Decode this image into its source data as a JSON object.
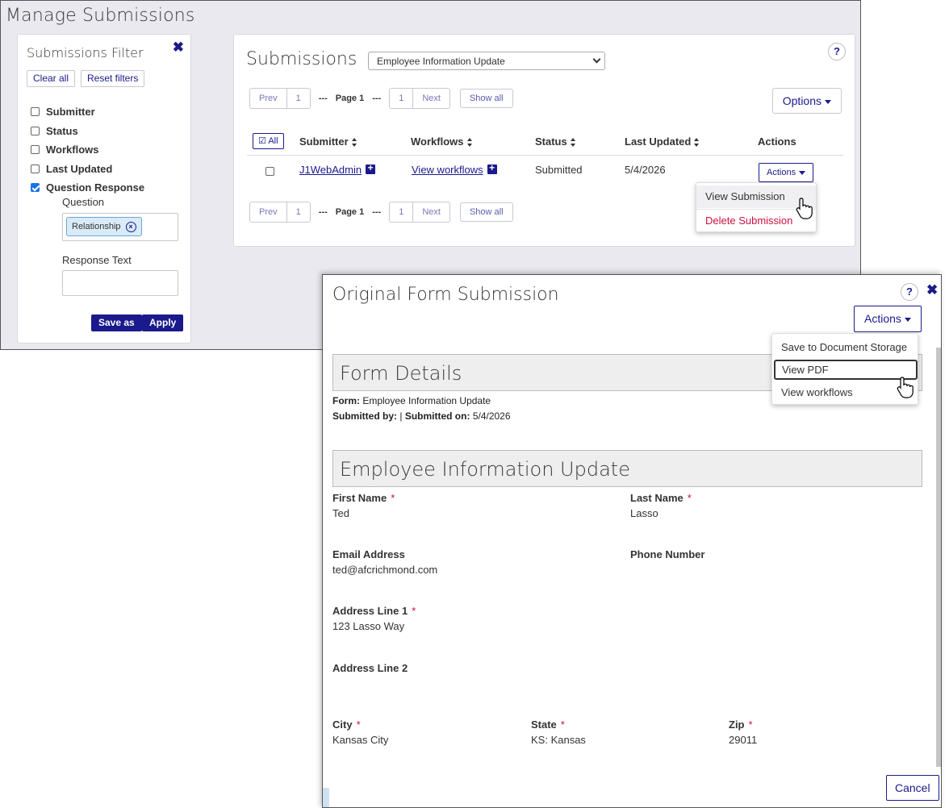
{
  "manage": {
    "title": "Manage Submissions"
  },
  "filter": {
    "title": "Submissions Filter",
    "clear_all": "Clear all",
    "reset_filters": "Reset filters",
    "options": [
      {
        "label": "Submitter",
        "checked": false
      },
      {
        "label": "Status",
        "checked": false
      },
      {
        "label": "Workflows",
        "checked": false
      },
      {
        "label": "Last Updated",
        "checked": false
      },
      {
        "label": "Question Response",
        "checked": true
      }
    ],
    "question_label": "Question",
    "question_chip": "Relationship",
    "response_text_label": "Response Text",
    "response_text_value": "",
    "save_as": "Save as",
    "apply": "Apply"
  },
  "submissions": {
    "title": "Submissions",
    "selected_form": "Employee Information Update",
    "help": "?",
    "options_label": "Options",
    "pager": {
      "prev": "Prev",
      "first": "1",
      "dots": "---",
      "page_label": "Page 1",
      "last": "1",
      "next": "Next",
      "show_all": "Show all"
    },
    "all_label": "All",
    "columns": [
      "Submitter",
      "Workflows",
      "Status",
      "Last Updated",
      "Actions"
    ],
    "rows": [
      {
        "submitter": "J1WebAdmin",
        "workflows": "View workflows",
        "status": "Submitted",
        "last_updated": "5/4/2026",
        "actions": "Actions"
      }
    ],
    "row_menu": {
      "view": "View Submission",
      "delete": "Delete Submission"
    }
  },
  "modal": {
    "title": "Original Form Submission",
    "help": "?",
    "actions_label": "Actions",
    "menu": {
      "save": "Save to Document Storage",
      "pdf": "View PDF",
      "workflows": "View workflows"
    },
    "form_details_header": "Form Details",
    "form_label": "Form:",
    "form_value": "Employee Information Update",
    "submitted_by_label": "Submitted by:",
    "separator": "|",
    "submitted_on_label": "Submitted on:",
    "submitted_on_value": "5/4/2026",
    "section_header": "Employee Information Update",
    "fields": {
      "first_name_label": "First Name",
      "first_name_value": "Ted",
      "last_name_label": "Last Name",
      "last_name_value": "Lasso",
      "email_label": "Email Address",
      "email_value": "ted@afcrichmond.com",
      "phone_label": "Phone Number",
      "address1_label": "Address Line 1",
      "address1_value": "123 Lasso Way",
      "address2_label": "Address Line 2",
      "city_label": "City",
      "city_value": "Kansas City",
      "state_label": "State",
      "state_value": "KS: Kansas",
      "zip_label": "Zip",
      "zip_value": "29011",
      "required_mark": "*"
    },
    "cancel": "Cancel"
  },
  "colors": {
    "brand": "#1a1a8c",
    "required": "#cc1133",
    "delete": "#cc1144",
    "panel_bg": "#e9e9ef"
  }
}
